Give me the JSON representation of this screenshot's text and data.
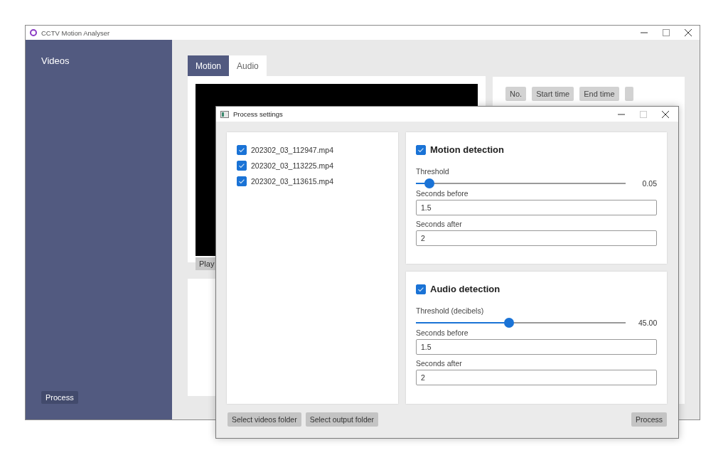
{
  "main_window": {
    "title": "CCTV Motion Analyser",
    "sidebar": {
      "heading": "Videos",
      "process_button": "Process"
    },
    "tabs": [
      {
        "label": "Motion",
        "selected": true
      },
      {
        "label": "Audio",
        "selected": false
      }
    ],
    "play_button": "Play",
    "table_columns": [
      "No.",
      "Start time",
      "End time"
    ]
  },
  "dialog": {
    "title": "Process settings",
    "videos": [
      {
        "name": "202302_03_112947.mp4",
        "checked": true
      },
      {
        "name": "202302_03_113225.mp4",
        "checked": true
      },
      {
        "name": "202302_03_113615.mp4",
        "checked": true
      }
    ],
    "sections": [
      {
        "title": "Motion detection",
        "checked": true,
        "threshold_label": "Threshold",
        "level": 0.066,
        "reading": "0.05",
        "before_label": "Seconds before",
        "before_value": "1.5",
        "after_label": "Seconds after",
        "after_value": "2"
      },
      {
        "title": "Audio detection",
        "checked": true,
        "threshold_label": "Threshold (decibels)",
        "level": 0.445,
        "reading": "45.00",
        "before_label": "Seconds before",
        "before_value": "1.5",
        "after_label": "Seconds after",
        "after_value": "2"
      }
    ],
    "buttons": {
      "select_videos": "Select videos folder",
      "select_output": "Select output folder",
      "process": "Process"
    }
  }
}
